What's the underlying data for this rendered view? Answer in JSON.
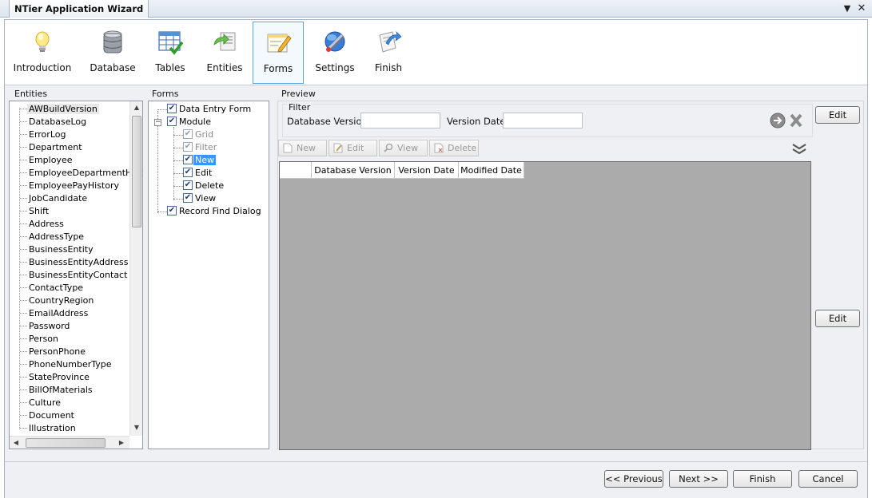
{
  "window": {
    "title": "NTier Application Wizard"
  },
  "steps": [
    {
      "label": "Introduction",
      "icon": "lightbulb-icon"
    },
    {
      "label": "Database",
      "icon": "database-icon"
    },
    {
      "label": "Tables",
      "icon": "tables-icon"
    },
    {
      "label": "Entities",
      "icon": "entities-icon"
    },
    {
      "label": "Forms",
      "icon": "forms-icon",
      "selected": true
    },
    {
      "label": "Settings",
      "icon": "settings-icon"
    },
    {
      "label": "Finish",
      "icon": "finish-icon"
    }
  ],
  "entities": {
    "label": "Entities",
    "items": [
      "AWBuildVersion",
      "DatabaseLog",
      "ErrorLog",
      "Department",
      "Employee",
      "EmployeeDepartmentHist",
      "EmployeePayHistory",
      "JobCandidate",
      "Shift",
      "Address",
      "AddressType",
      "BusinessEntity",
      "BusinessEntityAddress",
      "BusinessEntityContact",
      "ContactType",
      "CountryRegion",
      "EmailAddress",
      "Password",
      "Person",
      "PersonPhone",
      "PhoneNumberType",
      "StateProvince",
      "BillOfMaterials",
      "Culture",
      "Document",
      "Illustration"
    ],
    "selected": "AWBuildVersion"
  },
  "forms": {
    "label": "Forms",
    "tree": [
      {
        "label": "Data Entry Form",
        "checked": true,
        "level": 0
      },
      {
        "label": "Module",
        "checked": true,
        "level": 0,
        "expanded": true
      },
      {
        "label": "Grid",
        "checked": true,
        "level": 1,
        "disabled": true
      },
      {
        "label": "Filter",
        "checked": true,
        "level": 1,
        "disabled": true
      },
      {
        "label": "New",
        "checked": true,
        "level": 1,
        "selected": true
      },
      {
        "label": "Edit",
        "checked": true,
        "level": 1
      },
      {
        "label": "Delete",
        "checked": true,
        "level": 1
      },
      {
        "label": "View",
        "checked": true,
        "level": 1
      },
      {
        "label": "Record Find Dialog",
        "checked": true,
        "level": 0
      }
    ]
  },
  "preview": {
    "label": "Preview",
    "filter": {
      "label": "Filter",
      "fields": [
        {
          "label": "Database Version:",
          "value": ""
        },
        {
          "label": "Version Date:",
          "value": ""
        }
      ]
    },
    "toolbar": {
      "new": "New",
      "edit": "Edit",
      "view": "View",
      "delete": "Delete"
    },
    "grid": {
      "columns": [
        "Database Version",
        "Version Date",
        "Modified Date"
      ]
    },
    "edit_label_1": "Edit",
    "edit_label_2": "Edit"
  },
  "footer": {
    "previous": "<< Previous",
    "next": "Next >>",
    "finish": "Finish",
    "cancel": "Cancel"
  },
  "colors": {
    "accent": "#3399ff",
    "grid_bg": "#ababab",
    "selected_step_border": "#5aa6e0"
  }
}
